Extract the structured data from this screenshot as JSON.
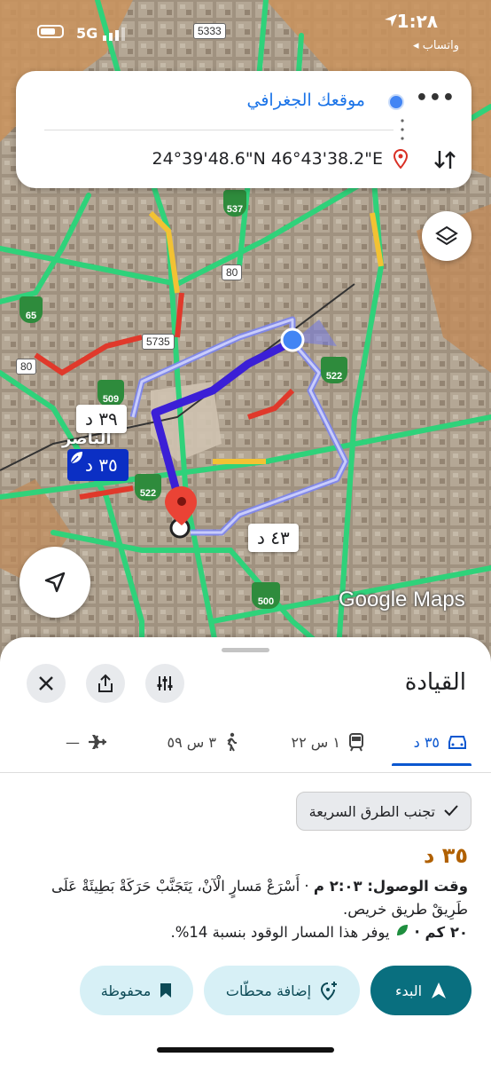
{
  "status_bar": {
    "time": "1:٢٨",
    "network": "5G",
    "back_label": "◂ واتساب"
  },
  "search": {
    "from_label": "موقعك الجغرافي",
    "to_value": "24°39'48.6\"N 46°43'38.2\"E",
    "more_label": "•••"
  },
  "map": {
    "route_labels": {
      "alt1": "٣٩ د",
      "selected": "٣٥ د",
      "alt2": "٤٣ د"
    },
    "road_shields": [
      "5333",
      "537",
      "80",
      "65",
      "5735",
      "80",
      "509",
      "522",
      "522",
      "500"
    ],
    "district_label": "الناصر",
    "watermark": "Google Maps"
  },
  "sheet": {
    "title": "القيادة",
    "modes": [
      {
        "icon": "car-icon",
        "label": "٣٥ د"
      },
      {
        "icon": "train-icon",
        "label": "١ س ٢٢"
      },
      {
        "icon": "walk-icon",
        "label": "٣ س ٥٩"
      },
      {
        "icon": "plane-icon",
        "label": "—"
      }
    ],
    "chip_label": "تجنب الطرق السريعة",
    "duration": "٣٥ د",
    "arrival_label": "وقت الوصول: ٢:٠٣ م",
    "arrival_detail": " · أَسْرَعْ مَسارٍ الْآنْ، يَتَجَنَّبْ حَرَكَةْ بَطِيئَةْ عَلَى طَرِيقْ طريق خريص.",
    "distance": "٢٠ كم ·",
    "fuel_text": "يوفر هذا المسار الوقود بنسبة 14%.",
    "actions": {
      "start": "البدء",
      "add_stops": "إضافة محطّات",
      "saved": "محفوظة"
    }
  },
  "colors": {
    "accent_blue": "#1a73e8",
    "route_selected": "#0b2fc4",
    "start_button": "#096f7f",
    "secondary_button": "#d7f0f6",
    "duration": "#b06000"
  }
}
